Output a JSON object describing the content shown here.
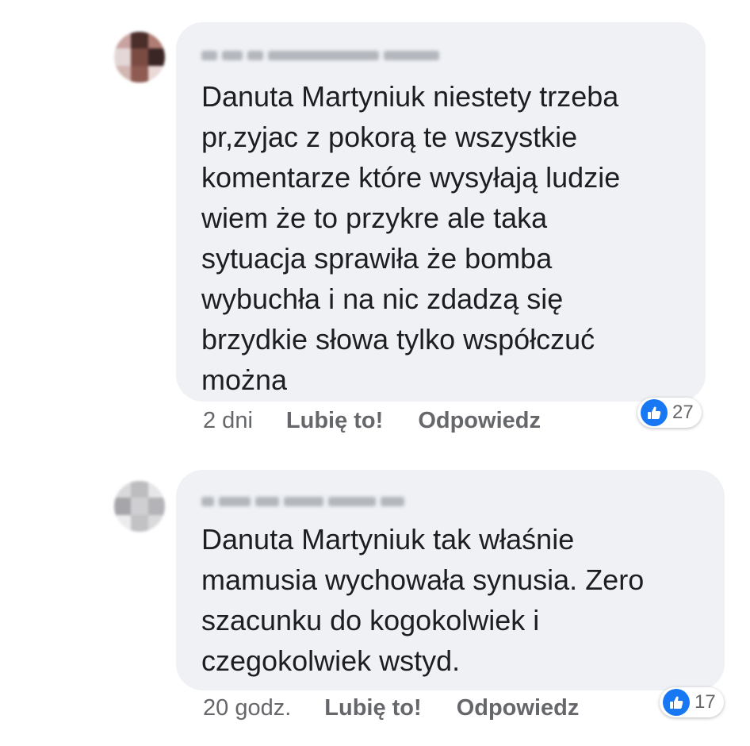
{
  "comments": [
    {
      "avatar_colors": [
        "#c8a3a0",
        "#4a2e2a",
        "#b07c73",
        "#e4d7d8",
        "#7a4b43",
        "#3a2624",
        "#d2b6b1",
        "#8e5a51",
        "#ead9d7"
      ],
      "text": "Danuta Martyniuk niestety trzeba\npr,zyjac z pokorą te wszystkie\nkomentarze które wysyłają ludzie\nwiem że to przykre ale taka\nsytuacja sprawiła że bomba\nwybuchła i na nic zdadzą się\nbrzydkie słowa tylko współczuć\nmożna",
      "time": "2 dni",
      "like_label": "Lubię to!",
      "reply_label": "Odpowiedz",
      "reaction_count": "27",
      "reaction_icon": "thumbs-up-icon"
    },
    {
      "avatar_colors": [
        "#d9d9db",
        "#bdbdc0",
        "#e6e6e8",
        "#a6a6aa",
        "#cfcfd2",
        "#b4b4b8",
        "#ececee",
        "#c2c2c5",
        "#dadadd"
      ],
      "text": "Danuta Martyniuk tak właśnie\nmamusia wychowała synusia. Zero\nszacunku do kogokolwiek i\nczegokolwiek wstyd.",
      "time": "20 godz.",
      "like_label": "Lubię to!",
      "reply_label": "Odpowiedz",
      "reaction_count": "17",
      "reaction_icon": "thumbs-up-icon"
    }
  ],
  "colors": {
    "bubble_bg": "#eff1f5",
    "like_blue": "#1877f2",
    "meta_gray": "#65676b"
  }
}
